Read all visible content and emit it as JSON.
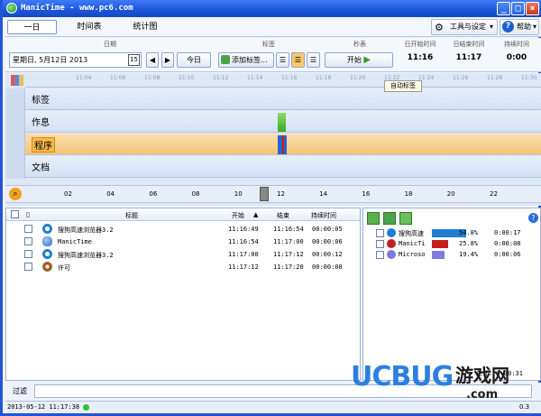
{
  "window": {
    "title": "ManicTime - www.pc6.com"
  },
  "tabs": [
    {
      "label": "一日"
    },
    {
      "label": "时间表"
    },
    {
      "label": "统计图"
    }
  ],
  "toolbar": {
    "tools_label": "工具与设定",
    "help_label": "帮助"
  },
  "controls": {
    "date_header": "日期",
    "date_value": "星期日, 5月12日 2013",
    "calendar_day": "15",
    "today_button": "今日",
    "tags_header": "标签",
    "add_tag_button": "添加标签...",
    "stopwatch_header": "秒表",
    "start_button": "开始",
    "day_start_header": "日开始时间",
    "day_start_value": "11:16",
    "day_end_header": "日结束时间",
    "day_end_value": "11:17",
    "duration_header": "持续时间",
    "duration_value": "0:00"
  },
  "timeline": {
    "ruler_ticks": [
      "11:04",
      "11:06",
      "11:08",
      "11:10",
      "11:12",
      "11:14",
      "11:16",
      "11:18",
      "11:20",
      "11:22",
      "11:24",
      "11:26",
      "11:28",
      "11:30"
    ],
    "tooltip": "自动标签",
    "lanes": [
      {
        "label": "标签"
      },
      {
        "label": "作息"
      },
      {
        "label": "程序"
      },
      {
        "label": "文档"
      }
    ],
    "axis_labels": [
      "02",
      "04",
      "06",
      "08",
      "10",
      "12",
      "14",
      "16",
      "18",
      "20",
      "22"
    ]
  },
  "list": {
    "columns": {
      "title": "标题",
      "start": "开始",
      "end": "结束",
      "duration": "持续时间"
    },
    "rows": [
      {
        "title": "搜狗高速浏览器3.2",
        "start": "11:16:49",
        "end": "11:16:54",
        "duration": "00:00:05",
        "icon": "sogou-icon"
      },
      {
        "title": "ManicTime",
        "start": "11:16:54",
        "end": "11:17:00",
        "duration": "00:00:06",
        "icon": "manictime-icon"
      },
      {
        "title": "搜狗高速浏览器3.2",
        "start": "11:17:00",
        "end": "11:17:12",
        "duration": "00:00:12",
        "icon": "sogou-icon"
      },
      {
        "title": "许可",
        "start": "11:17:12",
        "end": "11:17:20",
        "duration": "00:00:08",
        "icon": "license-icon"
      }
    ]
  },
  "summary": {
    "rows": [
      {
        "name": "搜狗高速",
        "percent": "54.8%",
        "duration": "0:00:17",
        "fraction": 0.548,
        "color": "#1e7fd0"
      },
      {
        "name": "ManicTi",
        "percent": "25.8%",
        "duration": "0:00:08",
        "fraction": 0.258,
        "color": "#c41e1e"
      },
      {
        "name": "Microso",
        "percent": "19.4%",
        "duration": "0:00:06",
        "fraction": 0.194,
        "color": "#7b7be0"
      }
    ],
    "total_label": "总计: 0:00:31"
  },
  "filter": {
    "label": "过滤"
  },
  "status": {
    "timestamp": "2013-05-12 11:17:38",
    "version": "0.3"
  },
  "watermark": {
    "brand": "UCBUG",
    "cn": "游戏网",
    "domain": ".com"
  }
}
